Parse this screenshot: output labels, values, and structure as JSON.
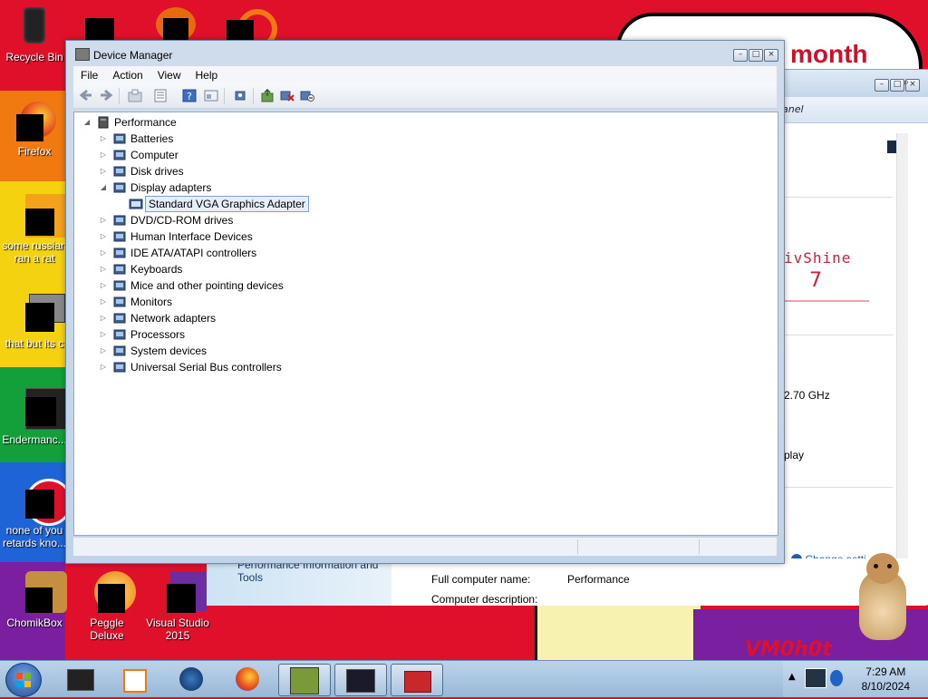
{
  "desktop": {
    "icons": [
      {
        "label": "Recycle Bin"
      },
      {
        "label": "Firefox"
      },
      {
        "label": "some russian ran a rat"
      },
      {
        "label": "that but its c"
      },
      {
        "label": "Endermanc..."
      },
      {
        "label": "none of you retards kno..."
      },
      {
        "label": "ChomikBox"
      },
      {
        "label": "Peggle Deluxe"
      },
      {
        "label": "Visual Studio 2015"
      }
    ],
    "wallpaper_text": "month",
    "watermark": "VM0h0t"
  },
  "background_window": {
    "address_partial": "anel",
    "branding_text": "ivShine",
    "branding_number": "7",
    "cpu_partial": "2.70 GHz",
    "display_partial": "play",
    "change_settings": "Change setti",
    "computer_name_label": "Full computer name:",
    "computer_name_value": "Performance",
    "computer_desc_label": "Computer description:",
    "perf_info_link": "Performance Information and Tools"
  },
  "device_manager": {
    "title": "Device Manager",
    "menu": [
      "File",
      "Action",
      "View",
      "Help"
    ],
    "tree": {
      "root": "Performance",
      "categories": [
        {
          "label": "Batteries",
          "expanded": false
        },
        {
          "label": "Computer",
          "expanded": false
        },
        {
          "label": "Disk drives",
          "expanded": false
        },
        {
          "label": "Display adapters",
          "expanded": true
        },
        {
          "label": "Standard VGA Graphics Adapter",
          "child": true,
          "selected": true
        },
        {
          "label": "DVD/CD-ROM drives",
          "expanded": false
        },
        {
          "label": "Human Interface Devices",
          "expanded": false
        },
        {
          "label": "IDE ATA/ATAPI controllers",
          "expanded": false
        },
        {
          "label": "Keyboards",
          "expanded": false
        },
        {
          "label": "Mice and other pointing devices",
          "expanded": false
        },
        {
          "label": "Monitors",
          "expanded": false
        },
        {
          "label": "Network adapters",
          "expanded": false
        },
        {
          "label": "Processors",
          "expanded": false
        },
        {
          "label": "System devices",
          "expanded": false
        },
        {
          "label": "Universal Serial Bus controllers",
          "expanded": false
        }
      ]
    }
  },
  "taskbar": {
    "time": "7:29 AM",
    "date": "8/10/2024"
  },
  "colors": {
    "selection": "#e5effb",
    "taskbar": "#98b8d8",
    "wallpaper_red": "#e0102a"
  }
}
